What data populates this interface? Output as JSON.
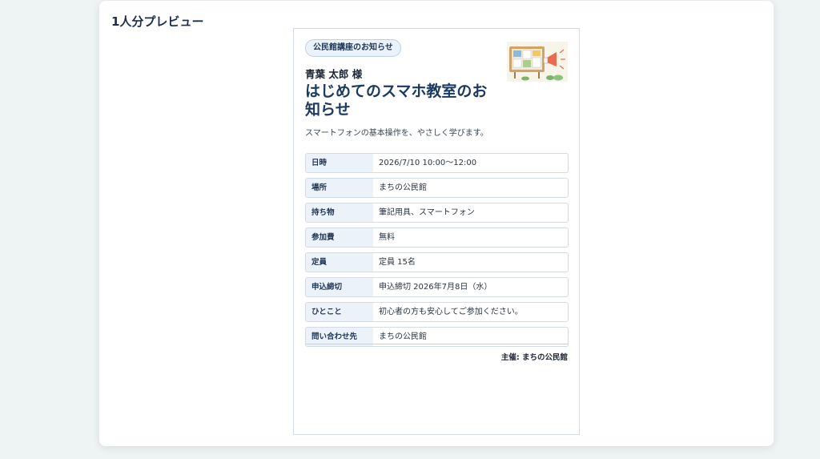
{
  "panel": {
    "title": "1人分プレビュー"
  },
  "notice": {
    "badge": "公民館講座のお知らせ",
    "illustration_icon": "bulletin-board-megaphone-icon",
    "recipient": "青葉 太郎 様",
    "title": "はじめてのスマホ教室のお知らせ",
    "subtitle": "スマートフォンの基本操作を、やさしく学びます。",
    "rows": [
      {
        "label": "日時",
        "value": "2026/7/10 10:00〜12:00"
      },
      {
        "label": "場所",
        "value": "まちの公民館"
      },
      {
        "label": "持ち物",
        "value": "筆記用具、スマートフォン"
      },
      {
        "label": "参加費",
        "value": "無料"
      },
      {
        "label": "定員",
        "value": "定員 15名"
      },
      {
        "label": "申込締切",
        "value": "申込締切 2026年7月8日（水）"
      },
      {
        "label": "ひとこと",
        "value": "初心者の方も安心してご参加ください。"
      },
      {
        "label": "問い合わせ先",
        "value": "まちの公民館"
      }
    ],
    "organizer": "主催: まちの公民館"
  },
  "colors": {
    "background": "#eef3f3",
    "title": "#1b3a63",
    "label_bg": "#ebf2f9",
    "badge_bg": "#eaf2fb"
  }
}
